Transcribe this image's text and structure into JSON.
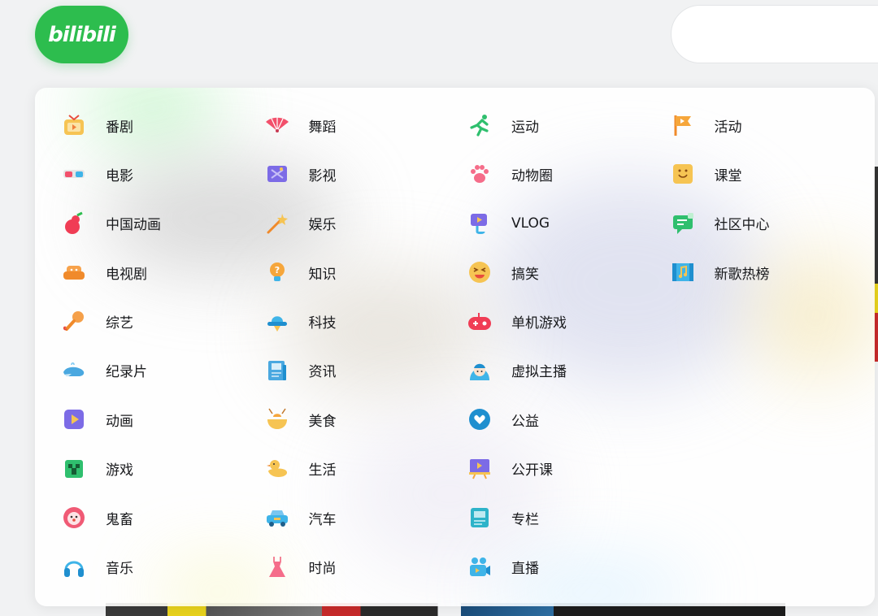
{
  "header": {
    "logo_text": "bilibili"
  },
  "colors": {
    "brand_green": "#2dbd4e",
    "text": "#18191c"
  },
  "categories": {
    "columns": [
      [
        {
          "label": "番剧",
          "icon": "tv-icon"
        },
        {
          "label": "电影",
          "icon": "3d-glasses-icon"
        },
        {
          "label": "中国动画",
          "icon": "gourd-icon"
        },
        {
          "label": "电视剧",
          "icon": "sofa-icon"
        },
        {
          "label": "综艺",
          "icon": "microphone-icon"
        },
        {
          "label": "纪录片",
          "icon": "whale-icon"
        },
        {
          "label": "动画",
          "icon": "play-square-icon"
        },
        {
          "label": "游戏",
          "icon": "creeper-icon"
        },
        {
          "label": "鬼畜",
          "icon": "clown-icon"
        },
        {
          "label": "音乐",
          "icon": "headphones-icon"
        }
      ],
      [
        {
          "label": "舞蹈",
          "icon": "fan-icon"
        },
        {
          "label": "影视",
          "icon": "clapperboard-icon"
        },
        {
          "label": "娱乐",
          "icon": "magic-wand-icon"
        },
        {
          "label": "知识",
          "icon": "lightbulb-icon"
        },
        {
          "label": "科技",
          "icon": "ufo-icon"
        },
        {
          "label": "资讯",
          "icon": "newspaper-icon"
        },
        {
          "label": "美食",
          "icon": "food-bowl-icon"
        },
        {
          "label": "生活",
          "icon": "duck-icon"
        },
        {
          "label": "汽车",
          "icon": "car-icon"
        },
        {
          "label": "时尚",
          "icon": "dress-icon"
        }
      ],
      [
        {
          "label": "运动",
          "icon": "runner-icon"
        },
        {
          "label": "动物圈",
          "icon": "paw-icon"
        },
        {
          "label": "VLOG",
          "icon": "vlog-camera-icon"
        },
        {
          "label": "搞笑",
          "icon": "laughing-face-icon"
        },
        {
          "label": "单机游戏",
          "icon": "gamepad-icon"
        },
        {
          "label": "虚拟主播",
          "icon": "vtuber-icon"
        },
        {
          "label": "公益",
          "icon": "heart-hands-icon"
        },
        {
          "label": "公开课",
          "icon": "presentation-icon"
        },
        {
          "label": "专栏",
          "icon": "article-icon"
        },
        {
          "label": "直播",
          "icon": "video-camera-icon"
        }
      ],
      [
        {
          "label": "活动",
          "icon": "flag-icon"
        },
        {
          "label": "课堂",
          "icon": "classroom-icon"
        },
        {
          "label": "社区中心",
          "icon": "chat-bubble-icon"
        },
        {
          "label": "新歌热榜",
          "icon": "music-chart-icon"
        }
      ]
    ]
  }
}
